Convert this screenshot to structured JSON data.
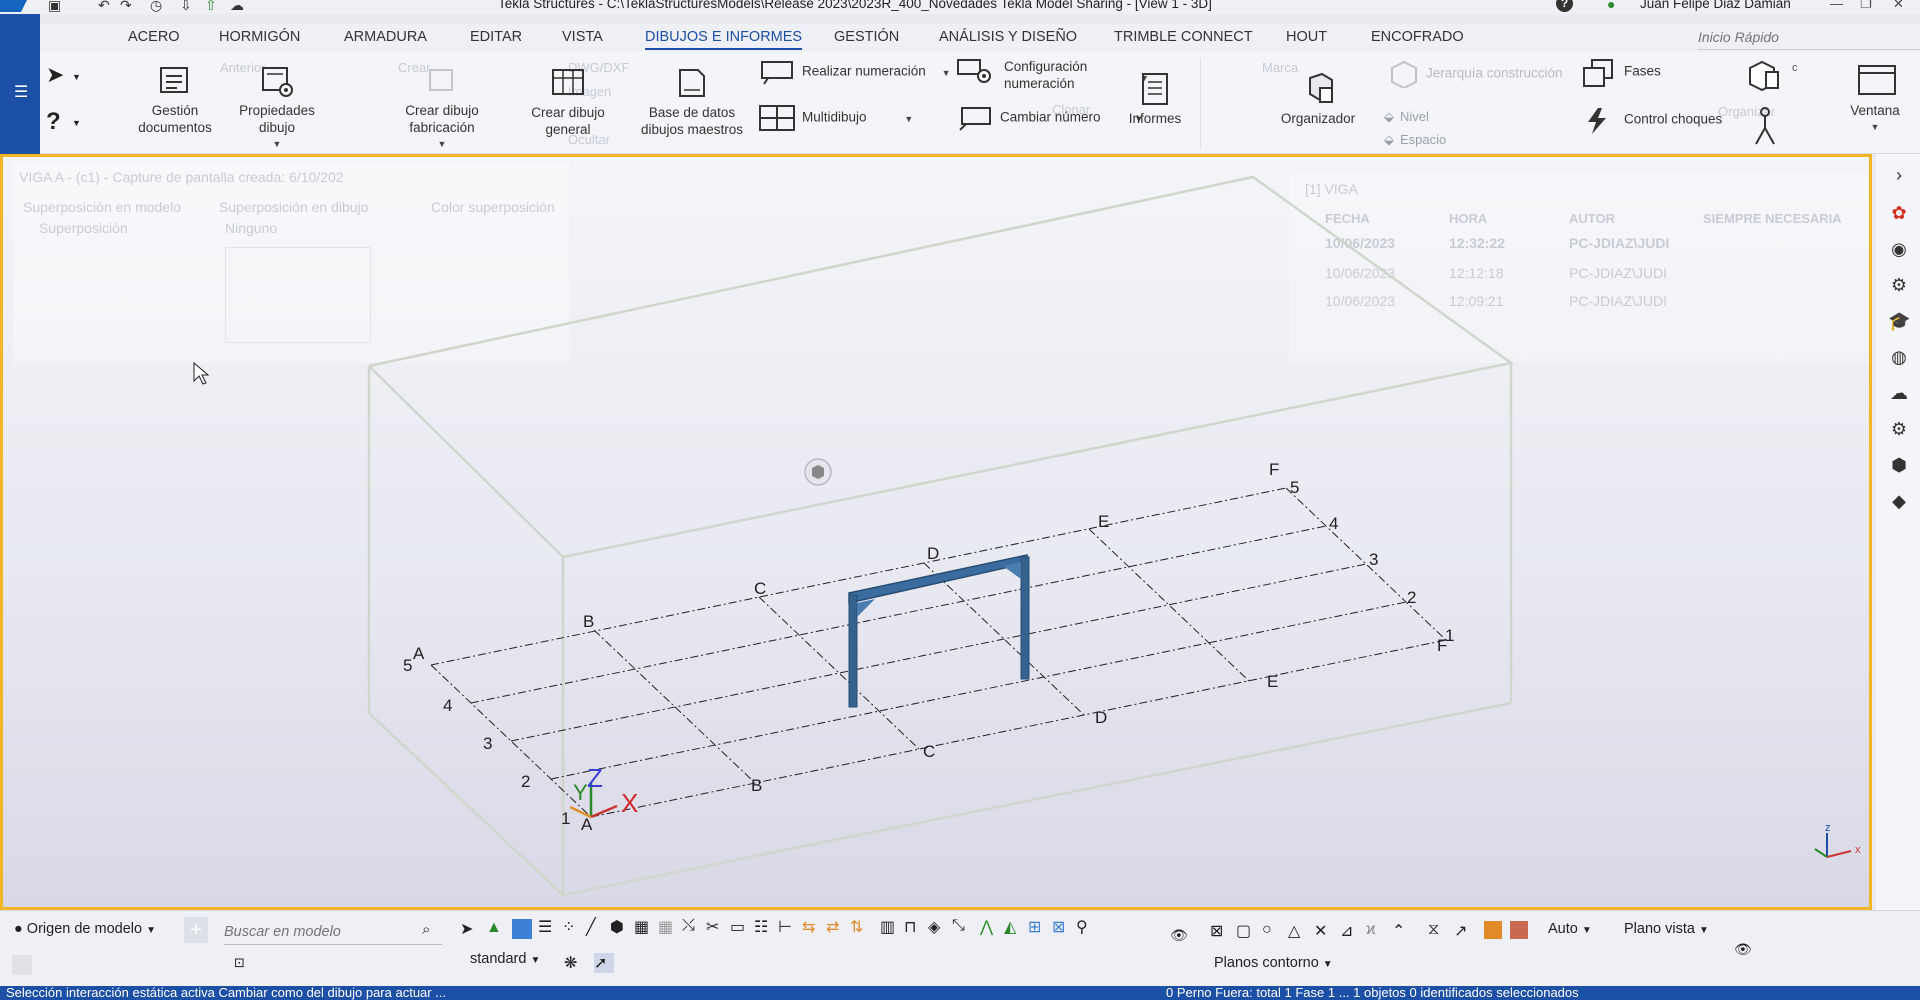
{
  "window": {
    "title": "Tekla Structures - C:\\TeklaStructuresModels\\Release 2023\\2023R_400_Novedades Tekla Model Sharing  - [View 1 -  3D]",
    "user": "Juan Felipe Diaz Damian",
    "help_label": "?"
  },
  "menu": {
    "tabs": [
      "ACERO",
      "HORMIGÓN",
      "ARMADURA",
      "EDITAR",
      "VISTA",
      "DIBUJOS E INFORMES",
      "GESTIÓN",
      "ANÁLISIS Y DISEÑO",
      "TRIMBLE CONNECT",
      "HOUT",
      "ENCOFRADO"
    ],
    "active_tab": "DIBUJOS E INFORMES",
    "quick_search_placeholder": "Inicio Rápido"
  },
  "ribbon": {
    "gestion_documentos": "Gestión documentos",
    "propiedades_dibujo": "Propiedades dibujo",
    "crear_dibujo_fabricacion": "Crear dibujo fabricación",
    "crear_dibujo_general": "Crear dibujo general",
    "base_datos": "Base de datos dibujos maestros",
    "realizar_numeracion": "Realizar numeración",
    "multidibujo": "Multidibujo",
    "configuracion_numeracion": "Configuración numeración",
    "cambiar_numero": "Cambiar número",
    "informes": "Informes",
    "organizador": "Organizador",
    "jerarquia": "Jerarquía construcción",
    "nivel": "Nivel",
    "espacio": "Espacio",
    "fases": "Fases",
    "control_choques": "Control choques",
    "ventana": "Ventana",
    "ghost_items": [
      "Anterior",
      "DWG/DXF",
      "Crear",
      "Imagen",
      "Ocultar",
      "Clonar",
      "Marca",
      "Organizar"
    ]
  },
  "viewport": {
    "grid_labels_letters": [
      "A",
      "B",
      "C",
      "D",
      "E",
      "F"
    ],
    "grid_labels_numbers": [
      "1",
      "2",
      "3",
      "4",
      "5"
    ],
    "axis_labels": {
      "z": "Z",
      "x": "X"
    },
    "mini_axis": {
      "z": "z",
      "x": "x"
    },
    "faded_panel": {
      "title": "VIGA A - (c1) - Capture de pantalla creada: 6/10/202",
      "col1": "Superposición en modelo",
      "col2": "Superposición en dibujo",
      "col3": "Color superposición",
      "checkbox": "Superposición",
      "dropdown": "Ninguno"
    },
    "faded_table": {
      "title": "[1] VIGA",
      "headers": [
        "FECHA",
        "HORA",
        "AUTOR",
        "SIEMPRE NECESARIA"
      ],
      "rows": [
        [
          "10/06/2023",
          "12:32:22",
          "PC-JDIAZ\\JUDI"
        ],
        [
          "10/06/2023",
          "12:12:18",
          "PC-JDIAZ\\JUDI"
        ],
        [
          "10/06/2023",
          "12:09:21",
          "PC-JDIAZ\\JUDI"
        ]
      ]
    }
  },
  "bottombar": {
    "origin_select": "Origen de modelo",
    "search_placeholder": "Buscar en modelo",
    "standard_select": "standard",
    "auto_select": "Auto",
    "plano_vista_select": "Plano vista",
    "planos_contorno_select": "Planos contorno"
  },
  "statusbar": {
    "left": "Selección interacción estática activa    Cambiar como del dibujo para actuar    ...",
    "right": "0  Perno   Fuera: total 1  Fase 1     ...   1  objetos    0  identificados seleccionados"
  },
  "colors": {
    "accent_blue": "#1c4fa6",
    "viewport_border": "#f2b624",
    "frame_steel": "#3b6c9f"
  }
}
